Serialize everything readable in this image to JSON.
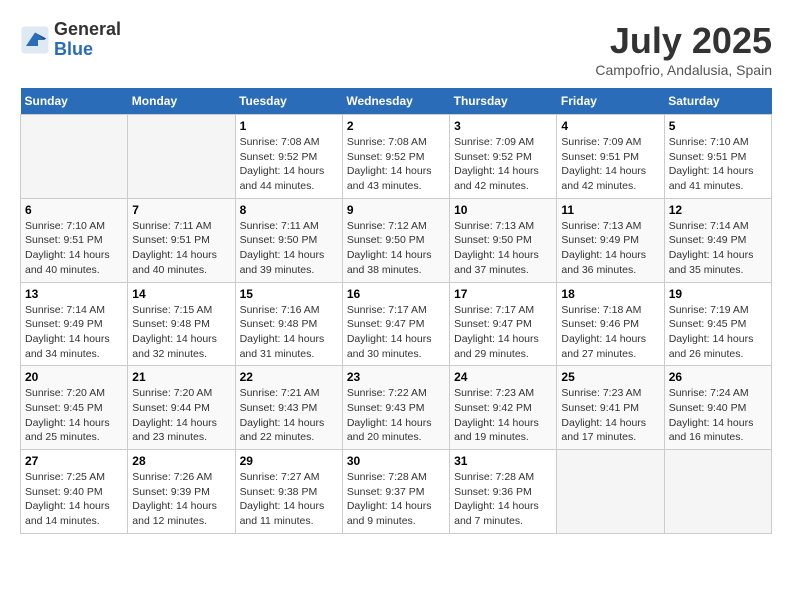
{
  "logo": {
    "general": "General",
    "blue": "Blue"
  },
  "title": {
    "month_year": "July 2025",
    "location": "Campofrio, Andalusia, Spain"
  },
  "weekdays": [
    "Sunday",
    "Monday",
    "Tuesday",
    "Wednesday",
    "Thursday",
    "Friday",
    "Saturday"
  ],
  "weeks": [
    [
      {
        "day": "",
        "content": ""
      },
      {
        "day": "",
        "content": ""
      },
      {
        "day": "1",
        "content": "Sunrise: 7:08 AM\nSunset: 9:52 PM\nDaylight: 14 hours and 44 minutes."
      },
      {
        "day": "2",
        "content": "Sunrise: 7:08 AM\nSunset: 9:52 PM\nDaylight: 14 hours and 43 minutes."
      },
      {
        "day": "3",
        "content": "Sunrise: 7:09 AM\nSunset: 9:52 PM\nDaylight: 14 hours and 42 minutes."
      },
      {
        "day": "4",
        "content": "Sunrise: 7:09 AM\nSunset: 9:51 PM\nDaylight: 14 hours and 42 minutes."
      },
      {
        "day": "5",
        "content": "Sunrise: 7:10 AM\nSunset: 9:51 PM\nDaylight: 14 hours and 41 minutes."
      }
    ],
    [
      {
        "day": "6",
        "content": "Sunrise: 7:10 AM\nSunset: 9:51 PM\nDaylight: 14 hours and 40 minutes."
      },
      {
        "day": "7",
        "content": "Sunrise: 7:11 AM\nSunset: 9:51 PM\nDaylight: 14 hours and 40 minutes."
      },
      {
        "day": "8",
        "content": "Sunrise: 7:11 AM\nSunset: 9:50 PM\nDaylight: 14 hours and 39 minutes."
      },
      {
        "day": "9",
        "content": "Sunrise: 7:12 AM\nSunset: 9:50 PM\nDaylight: 14 hours and 38 minutes."
      },
      {
        "day": "10",
        "content": "Sunrise: 7:13 AM\nSunset: 9:50 PM\nDaylight: 14 hours and 37 minutes."
      },
      {
        "day": "11",
        "content": "Sunrise: 7:13 AM\nSunset: 9:49 PM\nDaylight: 14 hours and 36 minutes."
      },
      {
        "day": "12",
        "content": "Sunrise: 7:14 AM\nSunset: 9:49 PM\nDaylight: 14 hours and 35 minutes."
      }
    ],
    [
      {
        "day": "13",
        "content": "Sunrise: 7:14 AM\nSunset: 9:49 PM\nDaylight: 14 hours and 34 minutes."
      },
      {
        "day": "14",
        "content": "Sunrise: 7:15 AM\nSunset: 9:48 PM\nDaylight: 14 hours and 32 minutes."
      },
      {
        "day": "15",
        "content": "Sunrise: 7:16 AM\nSunset: 9:48 PM\nDaylight: 14 hours and 31 minutes."
      },
      {
        "day": "16",
        "content": "Sunrise: 7:17 AM\nSunset: 9:47 PM\nDaylight: 14 hours and 30 minutes."
      },
      {
        "day": "17",
        "content": "Sunrise: 7:17 AM\nSunset: 9:47 PM\nDaylight: 14 hours and 29 minutes."
      },
      {
        "day": "18",
        "content": "Sunrise: 7:18 AM\nSunset: 9:46 PM\nDaylight: 14 hours and 27 minutes."
      },
      {
        "day": "19",
        "content": "Sunrise: 7:19 AM\nSunset: 9:45 PM\nDaylight: 14 hours and 26 minutes."
      }
    ],
    [
      {
        "day": "20",
        "content": "Sunrise: 7:20 AM\nSunset: 9:45 PM\nDaylight: 14 hours and 25 minutes."
      },
      {
        "day": "21",
        "content": "Sunrise: 7:20 AM\nSunset: 9:44 PM\nDaylight: 14 hours and 23 minutes."
      },
      {
        "day": "22",
        "content": "Sunrise: 7:21 AM\nSunset: 9:43 PM\nDaylight: 14 hours and 22 minutes."
      },
      {
        "day": "23",
        "content": "Sunrise: 7:22 AM\nSunset: 9:43 PM\nDaylight: 14 hours and 20 minutes."
      },
      {
        "day": "24",
        "content": "Sunrise: 7:23 AM\nSunset: 9:42 PM\nDaylight: 14 hours and 19 minutes."
      },
      {
        "day": "25",
        "content": "Sunrise: 7:23 AM\nSunset: 9:41 PM\nDaylight: 14 hours and 17 minutes."
      },
      {
        "day": "26",
        "content": "Sunrise: 7:24 AM\nSunset: 9:40 PM\nDaylight: 14 hours and 16 minutes."
      }
    ],
    [
      {
        "day": "27",
        "content": "Sunrise: 7:25 AM\nSunset: 9:40 PM\nDaylight: 14 hours and 14 minutes."
      },
      {
        "day": "28",
        "content": "Sunrise: 7:26 AM\nSunset: 9:39 PM\nDaylight: 14 hours and 12 minutes."
      },
      {
        "day": "29",
        "content": "Sunrise: 7:27 AM\nSunset: 9:38 PM\nDaylight: 14 hours and 11 minutes."
      },
      {
        "day": "30",
        "content": "Sunrise: 7:28 AM\nSunset: 9:37 PM\nDaylight: 14 hours and 9 minutes."
      },
      {
        "day": "31",
        "content": "Sunrise: 7:28 AM\nSunset: 9:36 PM\nDaylight: 14 hours and 7 minutes."
      },
      {
        "day": "",
        "content": ""
      },
      {
        "day": "",
        "content": ""
      }
    ]
  ]
}
